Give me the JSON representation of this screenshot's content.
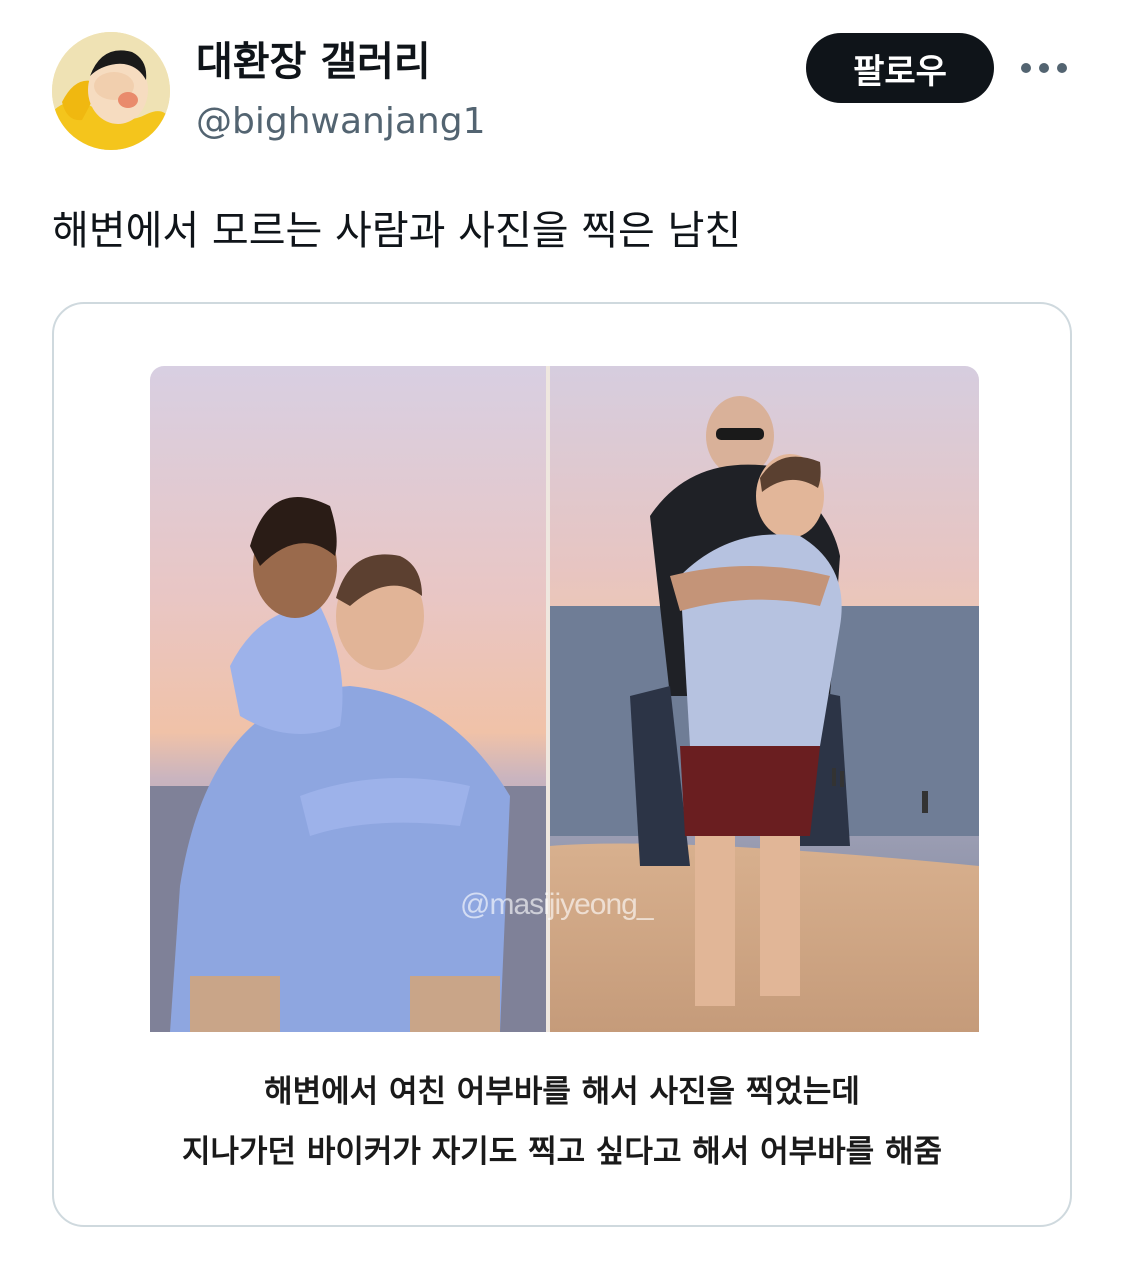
{
  "author": {
    "display_name": "대환장 갤러리",
    "handle": "@bighwanjang1",
    "avatar_icon": "cartoon-avatar-icon"
  },
  "actions": {
    "follow_label": "팔로우",
    "more_icon": "more-dots-icon"
  },
  "tweet": {
    "text": "해변에서 모르는 사람과 사진을 찍은 남친"
  },
  "media": {
    "watermark": "@masijiyeong_",
    "caption_lines": [
      "해변에서 여친 어부바를 해서 사진을 찍었는데",
      "지나가던 바이커가 자기도 찍고 싶다고 해서 어부바를 해줌"
    ]
  },
  "colors": {
    "text_primary": "#0f1419",
    "text_secondary": "#536471",
    "follow_bg": "#0f1419",
    "card_border": "#cfd9de"
  }
}
